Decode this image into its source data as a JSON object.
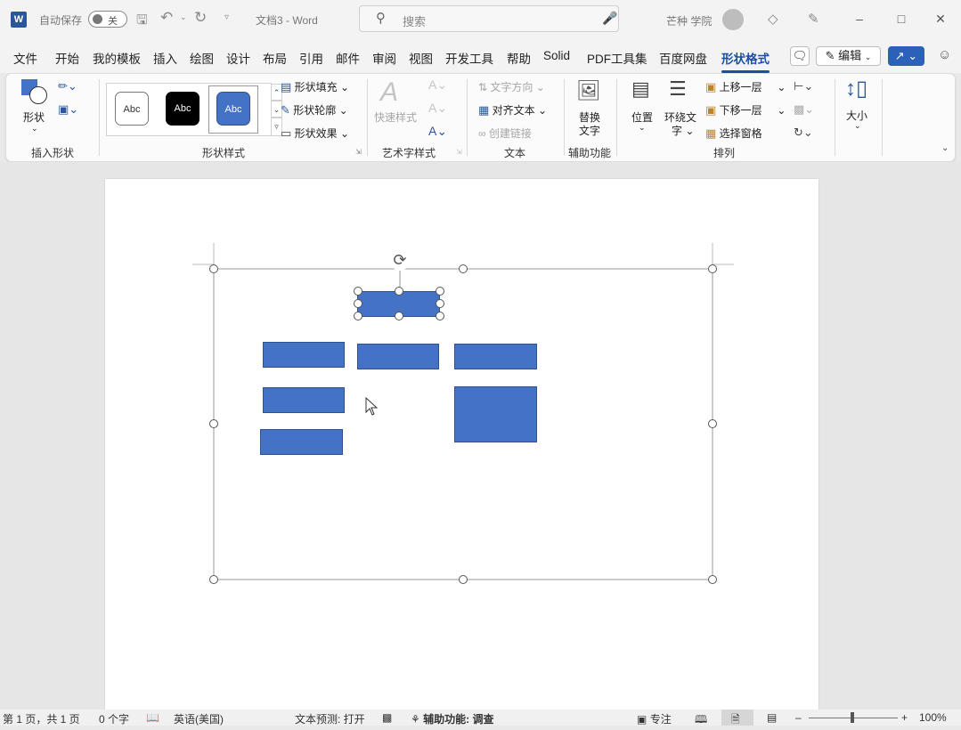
{
  "titlebar": {
    "autosave_label": "自动保存",
    "autosave_state": "关",
    "doc_title": "文档3 - Word",
    "search_placeholder": "搜索",
    "user_name": "芒种 学院"
  },
  "menu": {
    "items": [
      "文件",
      "开始",
      "我的模板",
      "插入",
      "绘图",
      "设计",
      "布局",
      "引用",
      "邮件",
      "审阅",
      "视图",
      "开发工具",
      "帮助",
      "Solid",
      "PDF工具集",
      "百度网盘",
      "形状格式"
    ],
    "active": "形状格式",
    "edit_label": "编辑"
  },
  "ribbon": {
    "insert_shapes": {
      "shape_label": "形状",
      "group_label": "插入形状"
    },
    "shape_styles": {
      "styles": [
        "Abc",
        "Abc",
        "Abc"
      ],
      "fill_label": "形状填充",
      "outline_label": "形状轮廓",
      "effect_label": "形状效果",
      "group_label": "形状样式"
    },
    "wordart": {
      "quick_styles_label": "快速样式",
      "group_label": "艺术字样式"
    },
    "text": {
      "direction_label": "文字方向",
      "align_label": "对齐文本",
      "link_label": "创建链接",
      "group_label": "文本"
    },
    "accessibility": {
      "alt_text_label_1": "替换",
      "alt_text_label_2": "文字",
      "group_label": "辅助功能"
    },
    "arrange": {
      "position_label": "位置",
      "wrap_label_1": "环绕文",
      "wrap_label_2": "字",
      "bring_forward_label": "上移一层",
      "send_backward_label": "下移一层",
      "selection_pane_label": "选择窗格",
      "group_label": "排列"
    },
    "size": {
      "label": "大小"
    }
  },
  "statusbar": {
    "page_info": "第 1 页，共 1 页",
    "word_count": "0 个字",
    "language": "英语(美国)",
    "text_prediction": "文本预测: 打开",
    "accessibility": "辅助功能: 调查",
    "focus": "专注",
    "zoom": "100%"
  },
  "colors": {
    "shape_fill": "#4472c4",
    "shape_border": "#2f528f",
    "accent": "#1a4fa3",
    "word_blue": "#2b579a"
  }
}
